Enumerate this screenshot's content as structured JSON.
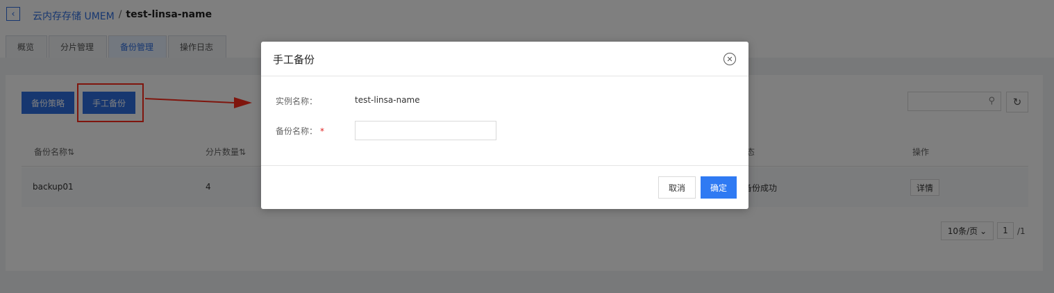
{
  "breadcrumb": {
    "back_icon": "chevron-left-icon",
    "service": "云内存存储 UMEM",
    "separator": "/",
    "instance": "test-linsa-name"
  },
  "tabs": [
    {
      "label": "概览",
      "active": false
    },
    {
      "label": "分片管理",
      "active": false
    },
    {
      "label": "备份管理",
      "active": true
    },
    {
      "label": "操作日志",
      "active": false
    }
  ],
  "toolbar": {
    "policy_label": "备份策略",
    "manual_label": "手工备份",
    "search_icon": "search-icon",
    "refresh_icon": "refresh-icon"
  },
  "table": {
    "headers": {
      "name": "备份名称⇅",
      "shards": "分片数量⇅",
      "status": "态",
      "action": "操作"
    },
    "rows": [
      {
        "name": "backup01",
        "shards": "4",
        "status": "备份成功",
        "action": "详情"
      }
    ]
  },
  "pagination": {
    "page_size": "10条/页",
    "page": "1",
    "total": "/1"
  },
  "modal": {
    "title": "手工备份",
    "close_icon": "close-circle-icon",
    "instance_label": "实例名称：",
    "instance_value": "test-linsa-name",
    "backup_label": "备份名称：",
    "required_mark": "*",
    "backup_value": "",
    "cancel_label": "取消",
    "ok_label": "确定"
  },
  "colors": {
    "primary": "#2f6fe0",
    "confirm": "#2f7af3",
    "annotation": "#ff2b1a"
  }
}
